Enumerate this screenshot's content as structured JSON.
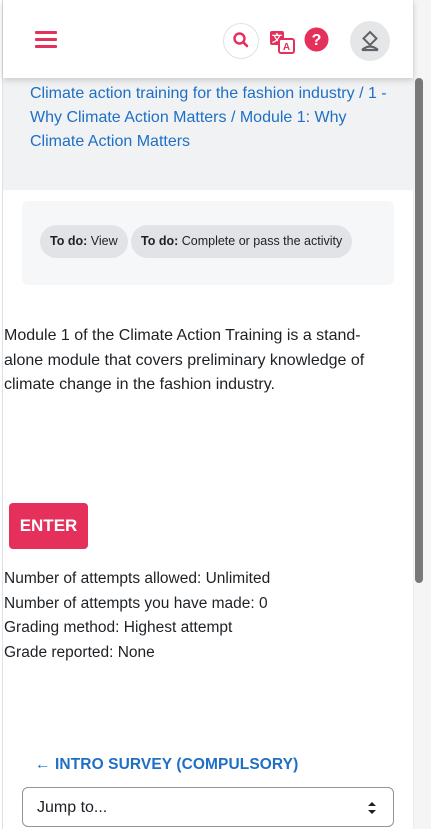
{
  "navbar": {
    "menu_icon": "hamburger-menu-icon",
    "search_icon": "search-icon",
    "language_icon": "language-translate-icon",
    "help_icon": "help-question-icon",
    "user_icon": "user-avatar-icon",
    "accent_color": "#e5305c"
  },
  "breadcrumb": {
    "items": [
      "Climate action training for the fashion industry",
      "1 - Why Climate Action Matters",
      "Module 1: Why Climate Action Matters"
    ],
    "separator": "/"
  },
  "completion": {
    "items": [
      {
        "prefix": "To do:",
        "text": "View"
      },
      {
        "prefix": "To do:",
        "text": "Complete or pass the activity"
      }
    ]
  },
  "intro": "Module 1 of the Climate Action Training is a stand-alone module that covers preliminary knowledge of climate change in the fashion industry.",
  "enter_label": "ENTER",
  "details": {
    "attempts_allowed": "Number of attempts allowed: Unlimited",
    "attempts_made": "Number of attempts you have made: 0",
    "grading_method": "Grading method: Highest attempt",
    "grade_reported": "Grade reported: None"
  },
  "navigation": {
    "prev_link": "← INTRO SURVEY (COMPULSORY)",
    "jump_placeholder": "Jump to..."
  }
}
